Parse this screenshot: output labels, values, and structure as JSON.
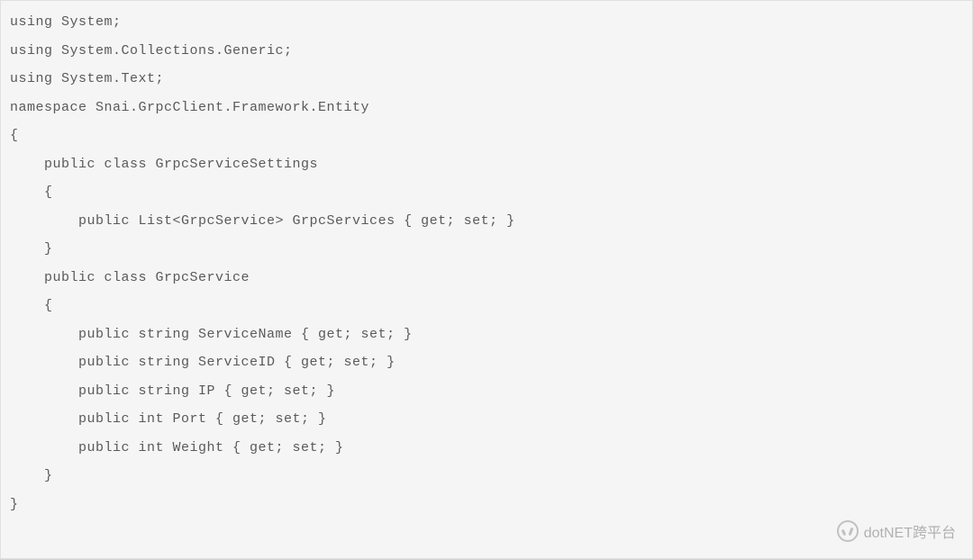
{
  "code": {
    "lines": [
      "using System;",
      "using System.Collections.Generic;",
      "using System.Text;",
      "",
      "namespace Snai.GrpcClient.Framework.Entity",
      "{",
      "    public class GrpcServiceSettings",
      "    {",
      "        public List<GrpcService> GrpcServices { get; set; }",
      "    }",
      "",
      "    public class GrpcService",
      "    {",
      "        public string ServiceName { get; set; }",
      "        public string ServiceID { get; set; }",
      "        public string IP { get; set; }",
      "        public int Port { get; set; }",
      "        public int Weight { get; set; }",
      "    }",
      "}"
    ]
  },
  "watermark": {
    "text": "dotNET跨平台"
  }
}
